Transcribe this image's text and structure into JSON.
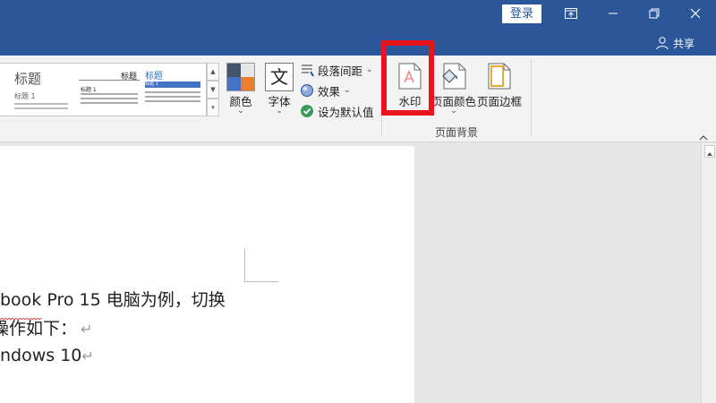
{
  "title_bar": {
    "login_label": "登录",
    "share_label": "共享"
  },
  "ribbon": {
    "style_gallery": {
      "preview1": {
        "title": "标题",
        "heading": "标题 1"
      },
      "preview2": {
        "title": "标题",
        "heading": "标题 1"
      },
      "preview3": {
        "title": "标题",
        "heading": "标题 1"
      }
    },
    "colors_label": "颜色",
    "fonts_label": "字体",
    "paragraph_spacing_label": "段落间距",
    "effects_label": "效果",
    "set_default_label": "设为默认值",
    "watermark_label": "水印",
    "page_color_label": "页面颜色",
    "page_borders_label": "页面边框",
    "page_background_group": "页面背景",
    "font_glyph": "文"
  },
  "document": {
    "lines": [
      {
        "text": "book Pro 15 电脑为例，切换",
        "return_mark": ""
      },
      {
        "text": "操作如下：",
        "return_mark": "↵"
      },
      {
        "text": "ndows 10",
        "return_mark": "↵"
      }
    ]
  },
  "colors": {
    "title_bar": "#2b579a",
    "highlight": "#e8141b"
  }
}
